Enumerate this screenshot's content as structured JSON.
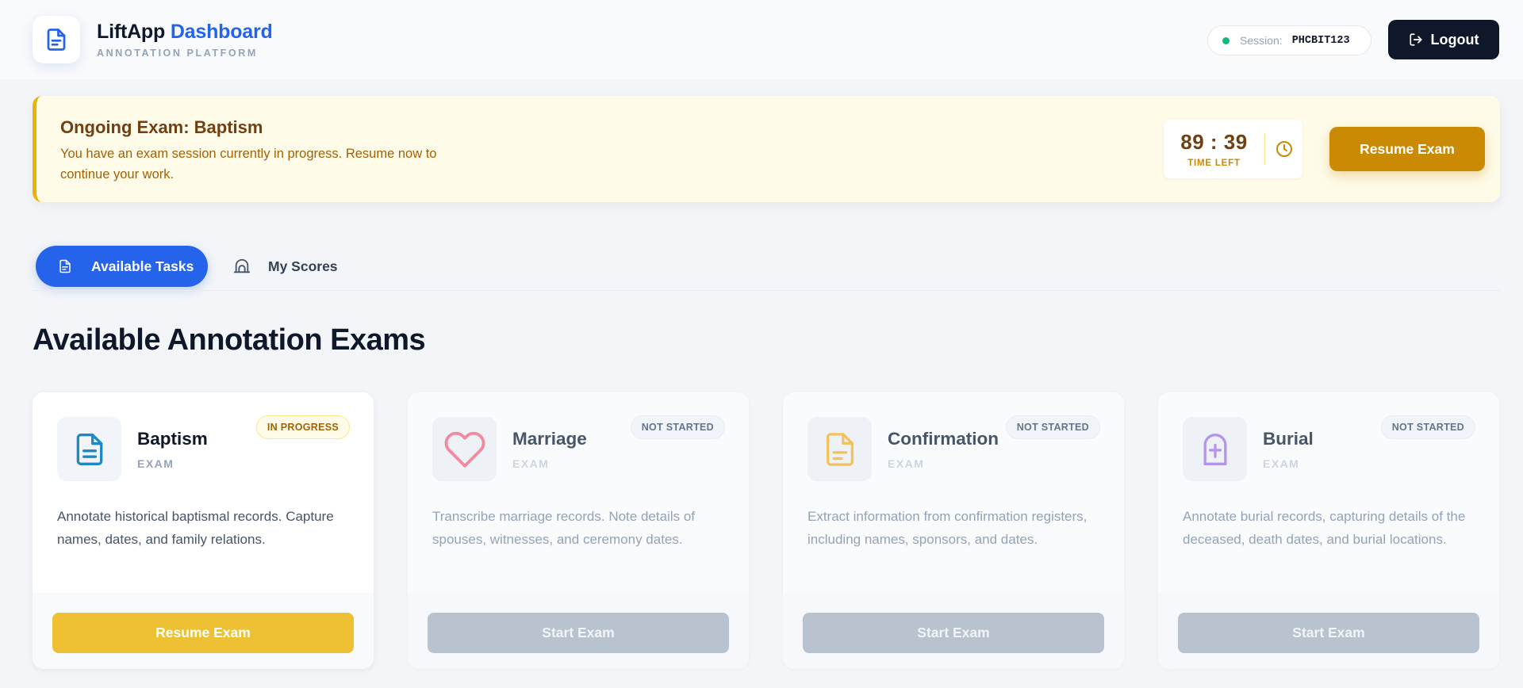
{
  "header": {
    "brand_name": "LiftApp",
    "brand_accent": "Dashboard",
    "brand_subtitle": "ANNOTATION PLATFORM",
    "session_label": "Session:",
    "session_code": "PHCBIT123",
    "logout_label": "Logout"
  },
  "banner": {
    "title": "Ongoing Exam: Baptism",
    "text": "You have an exam session currently in progress. Resume now to continue your work.",
    "timer": "89 : 39",
    "timer_label": "TIME LEFT",
    "resume_label": "Resume Exam"
  },
  "tabs": [
    {
      "label": "Available Tasks",
      "active": true
    },
    {
      "label": "My Scores",
      "active": false
    }
  ],
  "section_title": "Available Annotation Exams",
  "cards": [
    {
      "title": "Baptism",
      "subtitle": "EXAM",
      "status": "IN PROGRESS",
      "description": "Annotate historical baptismal records. Capture names, dates, and family relations.",
      "button": "Resume Exam",
      "icon": "document-icon"
    },
    {
      "title": "Marriage",
      "subtitle": "EXAM",
      "status": "NOT STARTED",
      "description": "Transcribe marriage records. Note details of spouses, witnesses, and ceremony dates.",
      "button": "Start Exam",
      "icon": "heart-icon"
    },
    {
      "title": "Confirmation",
      "subtitle": "EXAM",
      "status": "NOT STARTED",
      "description": "Extract information from confirmation registers, including names, sponsors, and dates.",
      "button": "Start Exam",
      "icon": "document-icon"
    },
    {
      "title": "Burial",
      "subtitle": "EXAM",
      "status": "NOT STARTED",
      "description": "Annotate burial records, capturing details of the deceased, death dates, and burial locations.",
      "button": "Start Exam",
      "icon": "cross-icon"
    }
  ],
  "colors": {
    "brand_accent": "#2563eb",
    "banner_bg": "#fefbe8",
    "resume": "#ca8a04",
    "resume_card": "#eec135",
    "disabled_button": "#b8c3cf",
    "session_dot": "#10b981"
  }
}
